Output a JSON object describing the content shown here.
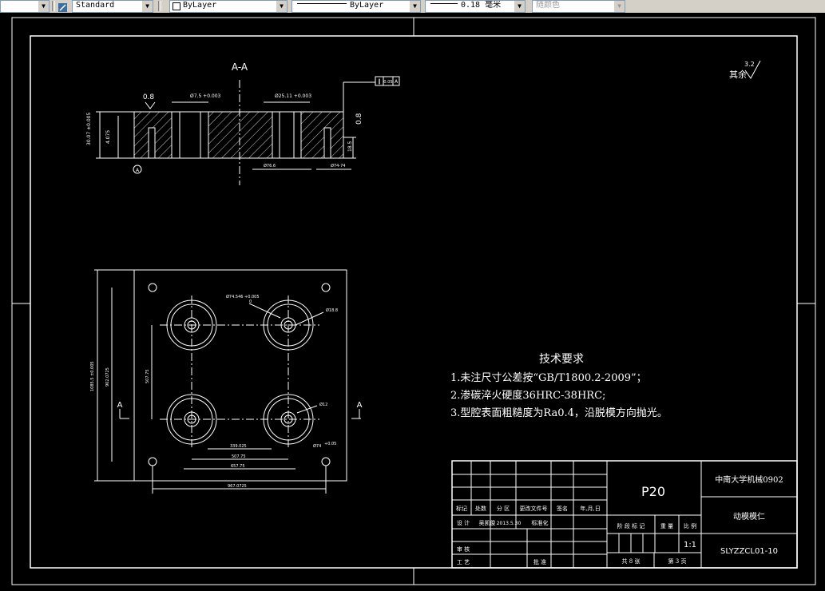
{
  "toolbar": {
    "first_value": "",
    "text_style": "Standard",
    "layer": "ByLayer",
    "linetype": "ByLayer",
    "lineweight": "0.18 毫米",
    "color": "随颜色"
  },
  "drawing": {
    "section_label": "A-A",
    "roughness_note": "其余",
    "roughness_value": "3.2",
    "tolerance_flatness": "0.05",
    "tolerance_datum": "A",
    "chamfer_left": "0.8",
    "chamfer_right": "0.8",
    "dim_hole_left": "Ø7.5 +0.003",
    "dim_hole_right": "Ø25.11 +0.003",
    "dim_height_a": "30.07 ±0.005",
    "dim_height_b": "4.075",
    "dim_depth": "18.5",
    "dim_bottom_a": "Ø76.6",
    "dim_bottom_b": "Ø74-74",
    "datum_marker": "A",
    "plan_dim_top": "Ø74.546 +0.005",
    "plan_dim_top_b": "0",
    "plan_dim_right_top": "Ø18.8",
    "plan_dim_right_mid": "Ø12",
    "plan_dim_right_bottom": "Ø74",
    "plan_dim_right_bottom_b": "+0.05",
    "plan_dim_vert_inner": "507.75",
    "plan_dim_vert_outer": "902.0725",
    "plan_dim_vert_total": "1085.5 ±0.005",
    "plan_dim_h1": "339.025",
    "plan_dim_h2": "507.75",
    "plan_dim_h3": "657.75",
    "plan_dim_h4": "967.0725",
    "section_arrow_left": "A",
    "section_arrow_right": "A"
  },
  "tech_requirements": {
    "title": "技术要求",
    "item1": "1.未注尺寸公差按“GB/T1800.2-2009”；",
    "item2": "2.渗碳淬火硬度36HRC-38HRC;",
    "item3": "3.型腔表面粗糙度为Ra0.4，沿脱模方向抛光。"
  },
  "title_block": {
    "part_code": "P20",
    "school": "中南大学机械0902",
    "part_name": "动模模仁",
    "drawing_no": "SLYZZCL01-10",
    "scale": "1:1",
    "row_marks": [
      "标记",
      "处数",
      "分 区",
      "更改文件号",
      "签名",
      "年,月,日"
    ],
    "design_label": "设 计",
    "designer": "吴凯俊",
    "date": "2013.5.30",
    "standard_label": "标准化",
    "stage_headers": [
      "阶 段 标 记",
      "重 量",
      "比 例"
    ],
    "review_label": "审 核",
    "process_label": "工 艺",
    "approve_label": "批 准",
    "sheets_total": "共 8 张",
    "sheet_no": "第 3 页"
  }
}
